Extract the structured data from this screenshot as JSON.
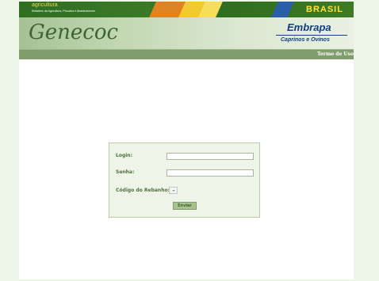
{
  "top_bar": {
    "title": "agricultura",
    "subtitle": "Ministério da Agricultura, Pecuária e Abastecimento",
    "brasil_logo": "BRASIL",
    "colors": {
      "bar": "#2f6d22",
      "yellow": "#f0d94a",
      "orange": "#e0821f"
    }
  },
  "header": {
    "app_logo": "Genecoc",
    "partner_logo": {
      "name": "Embrapa",
      "subtitle": "Caprinos e Ovinos",
      "color": "#123d86"
    }
  },
  "nav": {
    "terms_link": "Termo de Uso"
  },
  "login_form": {
    "login_label": "Login:",
    "login_value": "",
    "password_label": "Senha:",
    "password_value": "",
    "rebanho_label": "Código do Rebanho:",
    "rebanho_value": "",
    "submit_label": "Enviar"
  }
}
